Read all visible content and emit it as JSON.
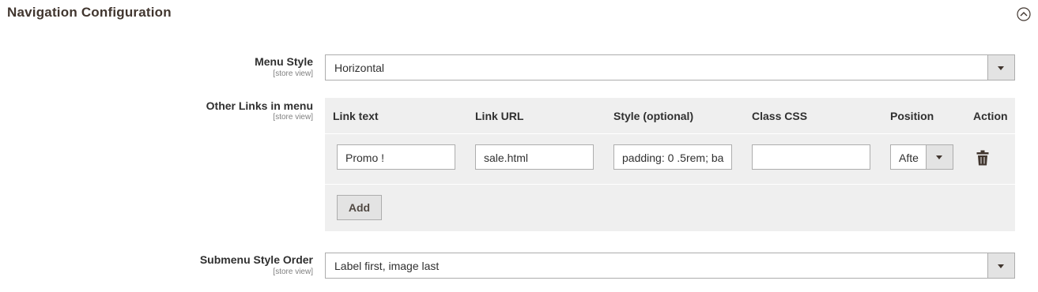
{
  "section": {
    "title": "Navigation Configuration",
    "collapse_icon": "chevron-up-circle-icon"
  },
  "menu_style": {
    "label": "Menu Style",
    "scope": "[store view]",
    "value": "Horizontal"
  },
  "other_links": {
    "label": "Other Links in menu",
    "scope": "[store view]",
    "columns": [
      "Link text",
      "Link URL",
      "Style (optional)",
      "Class CSS",
      "Position",
      "Action"
    ],
    "rows": [
      {
        "link_text": "Promo !",
        "link_url": "sale.html",
        "style": "padding: 0 .5rem; ba",
        "class_css": "",
        "position": "Afte",
        "action_icon": "trash-icon"
      }
    ],
    "add_label": "Add"
  },
  "submenu_style_order": {
    "label": "Submenu Style Order",
    "scope": "[store view]",
    "value": "Label first, image last"
  }
}
